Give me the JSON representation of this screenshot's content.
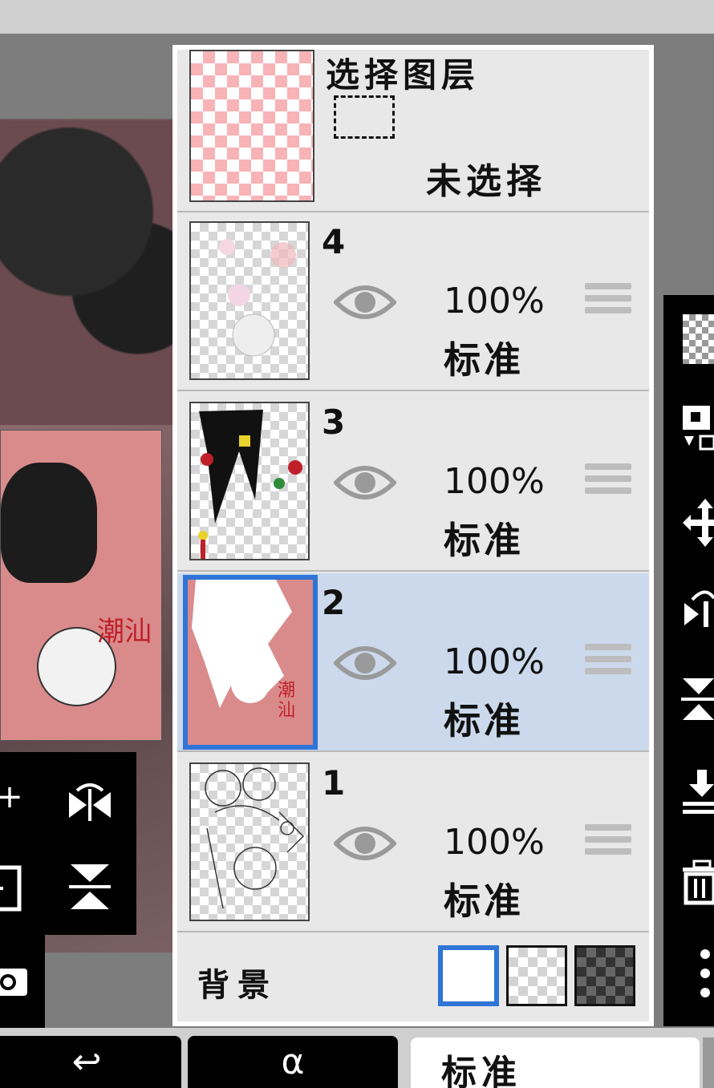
{
  "selection_layer": {
    "title": "选择图层",
    "status": "未选择"
  },
  "layers": [
    {
      "number": "4",
      "opacity": "100%",
      "blend": "标准",
      "visible": true,
      "selected": false
    },
    {
      "number": "3",
      "opacity": "100%",
      "blend": "标准",
      "visible": true,
      "selected": false
    },
    {
      "number": "2",
      "opacity": "100%",
      "blend": "标准",
      "visible": true,
      "selected": true
    },
    {
      "number": "1",
      "opacity": "100%",
      "blend": "标准",
      "visible": true,
      "selected": false
    }
  ],
  "background": {
    "label": "背景",
    "options": [
      "white",
      "checker-light",
      "checker-dark"
    ],
    "selected": "white"
  },
  "canvas": {
    "signature_text": "潮汕"
  },
  "left_toolbar": {
    "icons": [
      "add-layer-icon",
      "flip-horizontal-icon",
      "add-copy-icon",
      "flip-vertical-icon",
      "camera-icon"
    ]
  },
  "right_toolbar": {
    "icons": [
      "transparency-icon",
      "copy-layer-icon",
      "move-icon",
      "flip-h-icon",
      "flip-v-icon",
      "merge-down-icon",
      "trash-icon",
      "more-icon"
    ]
  },
  "bottom_bar": {
    "undo_icon": "↩",
    "alpha_lock_label": "α",
    "blend_mode": "标准"
  },
  "colors": {
    "selected_row": "#ccd9ec",
    "accent_blue": "#2f74d6",
    "panel_bg": "#e8e8e8"
  }
}
